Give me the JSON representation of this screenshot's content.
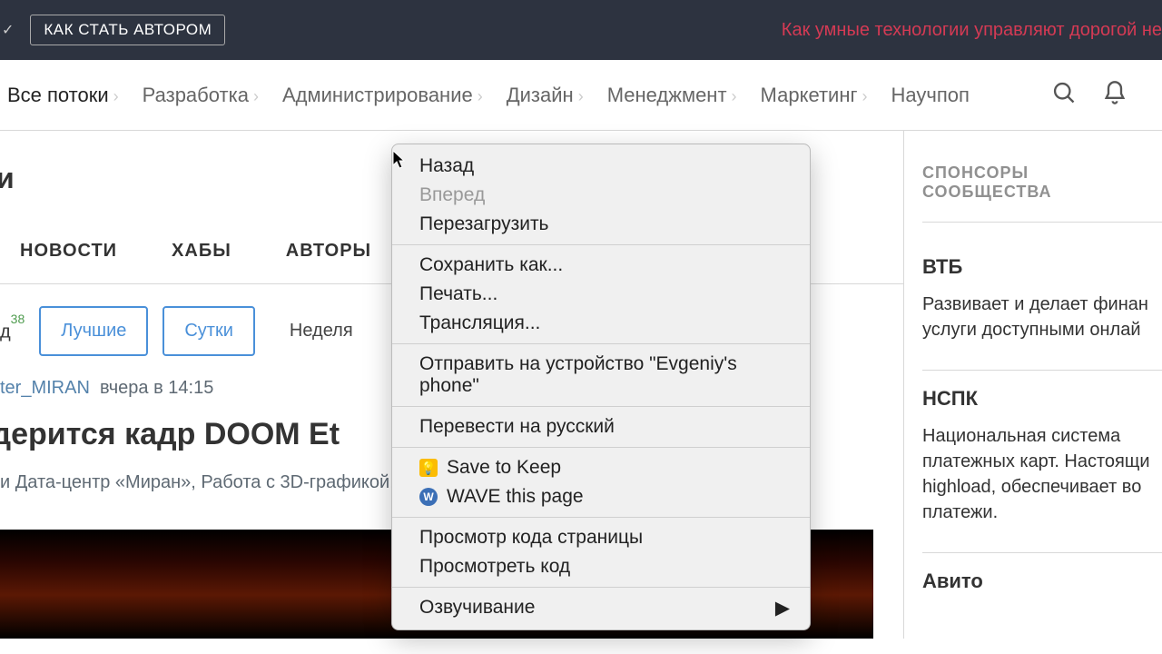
{
  "topbar": {
    "become_author": "КАК СТАТЬ АВТОРОМ",
    "ad_text": "Как умные технологии управляют дорогой не"
  },
  "nav": {
    "items": [
      "Все потоки",
      "Разработка",
      "Администрирование",
      "Дизайн",
      "Менеджмент",
      "Маркетинг",
      "Научпоп"
    ]
  },
  "main": {
    "page_title_fragment": "ки",
    "subnav": [
      "НОВОСТИ",
      "ХАБЫ",
      "АВТОРЫ"
    ],
    "filters": {
      "frag_label": "д",
      "frag_badge": "38",
      "best": "Лучшие",
      "day": "Сутки",
      "week": "Неделя"
    },
    "post": {
      "author": "ter_MIRAN",
      "time": "вчера в 14:15",
      "title_fragment": "ндерится кадр DOOM Et",
      "tags_fragment": "и Дата-центр «Миран»,  Работа с 3D-графикой,"
    }
  },
  "sidebar": {
    "heading": "СПОНСОРЫ СООБЩЕСТВА",
    "sponsors": [
      {
        "name": "ВТБ",
        "desc": "Развивает и делает финан услуги доступными онлай"
      },
      {
        "name": "НСПК",
        "desc": "Национальная система платежных карт. Настоящи highload, обеспечивает во платежи."
      },
      {
        "name": "Авито",
        "desc": ""
      }
    ]
  },
  "contextmenu": {
    "back": "Назад",
    "forward": "Вперед",
    "reload": "Перезагрузить",
    "save_as": "Сохранить как...",
    "print": "Печать...",
    "cast": "Трансляция...",
    "send_to_device": "Отправить на устройство \"Evgeniy's phone\"",
    "translate": "Перевести на русский",
    "save_to_keep": "Save to Keep",
    "wave": "WAVE this page",
    "view_source": "Просмотр кода страницы",
    "inspect": "Просмотреть код",
    "speech": "Озвучивание"
  }
}
